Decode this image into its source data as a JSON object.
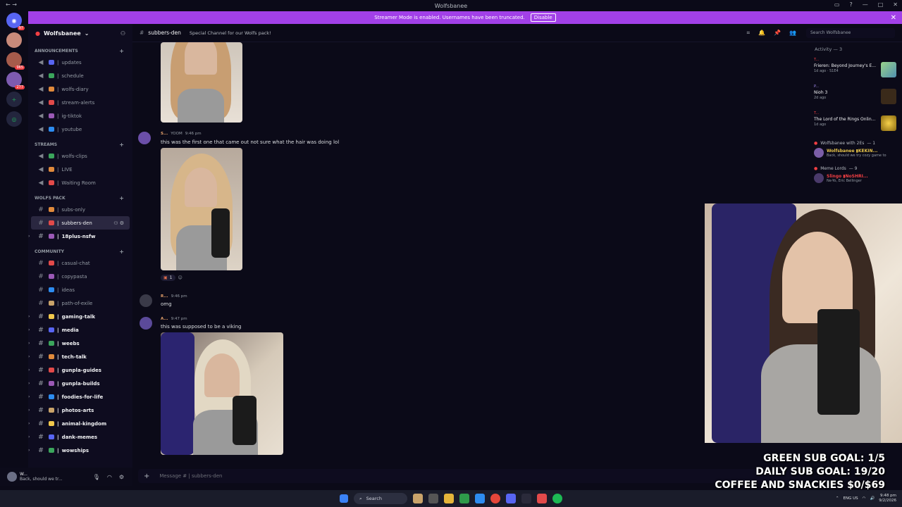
{
  "window": {
    "title": "Wolfsbanee"
  },
  "banner": {
    "text": "Streamer Mode is enabled. Usernames have been truncated.",
    "button": "Disable"
  },
  "servers": [
    {
      "name": "home",
      "badge": "97"
    },
    {
      "name": "server-1",
      "badge": ""
    },
    {
      "name": "server-2",
      "badge": "965"
    },
    {
      "name": "server-3",
      "badge": "277"
    }
  ],
  "guild": {
    "name": "Wolfsbanee"
  },
  "categories": [
    {
      "name": "ANNOUNCEMENTS",
      "channels": [
        "updates",
        "schedule",
        "wolfs-diary",
        "stream-alerts",
        "ig-tiktok",
        "youtube"
      ]
    },
    {
      "name": "STREAMS",
      "channels": [
        "wolfs-clips",
        "LIVE",
        "Waiting Room"
      ]
    },
    {
      "name": "WOLFS PACK",
      "channels": [
        "subs-only",
        "subbers-den",
        "18plus-nsfw"
      ]
    },
    {
      "name": "COMMUNITY",
      "channels": [
        "casual-chat",
        "copypasta",
        "ideas",
        "path-of-exile",
        "gaming-talk",
        "media",
        "weebs",
        "tech-talk",
        "gunpla-guides",
        "gunpla-builds",
        "foodies-for-life",
        "photos-arts",
        "animal-kingdom",
        "dank-memes",
        "wowships"
      ]
    }
  ],
  "user": {
    "name": "W...",
    "status": "Back, should we tr..."
  },
  "channel_header": {
    "name": "subbers-den",
    "topic": "Special Channel for our Wolfs pack!",
    "search_placeholder": "Search Wolfsbanee"
  },
  "messages": [
    {
      "author": "S...",
      "tag": "YOOM",
      "time": "9:46 pm",
      "text": "this was the first one that came out not sure what the hair was doing lol",
      "reaction_count": "1"
    },
    {
      "author": "R...",
      "tag": "",
      "time": "9:46 pm",
      "text": "omg"
    },
    {
      "author": "A...",
      "tag": "",
      "time": "9:47 pm",
      "text": "this was supposed to be a viking"
    }
  ],
  "composer": {
    "placeholder": "Message # | subbers-den"
  },
  "activity": {
    "title": "Activity — 3",
    "items": [
      {
        "user": "T...",
        "game": "Frieren: Beyond Journey's E...",
        "meta": "1d ago · S1E4"
      },
      {
        "user": "P...",
        "game": "Nioh 3",
        "meta": "2d ago"
      },
      {
        "user": "T...",
        "game": "The Lord of the Rings Onlin...",
        "meta": "1d ago"
      }
    ],
    "groups": [
      {
        "name": "Wolfsbanee with 2Es",
        "count": "— 1",
        "member": "Wolfsbanee ▮KEKIN...",
        "status": "Back, should we try cozy game to"
      },
      {
        "name": "Meme Lords",
        "count": "— 9",
        "member": "Slingo ▮NoSHRI...",
        "status": "Ne-Yo, Eric Bellinger"
      }
    ]
  },
  "goals": {
    "line1": "GREEN SUB GOAL: 1/5",
    "line2": "DAILY SUB GOAL: 19/20",
    "line3": "COFFEE AND SNACKIES $0/$69"
  },
  "taskbar": {
    "search": "Search",
    "lang": "ENG US",
    "time": "9:48 pm",
    "date": "9/2/2026"
  }
}
